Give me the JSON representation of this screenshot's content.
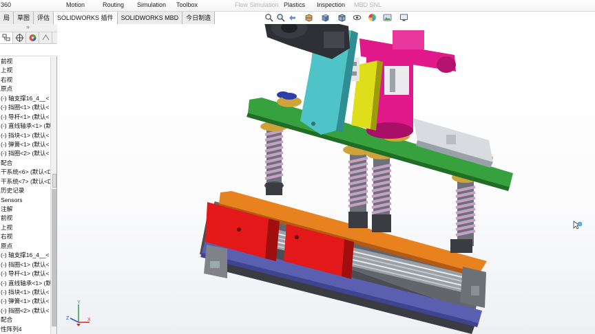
{
  "ribbon": {
    "items": [
      "360",
      "Motion",
      "Routing",
      "Simulation",
      "Toolbox",
      "Flow Simulation",
      "Plastics",
      "Inspection",
      "MBD SNL"
    ]
  },
  "tabs": [
    "局",
    "草图",
    "评估",
    "SOLIDWORKS 插件",
    "SOLIDWORKS MBD",
    "今日制造"
  ],
  "pane": {
    "collapse_glyph": "»",
    "tab_icons": [
      "feature-manager-icon",
      "property-manager-icon",
      "configuration-manager-icon",
      "dimxpert-icon"
    ],
    "tree": [
      "前视",
      "上视",
      "右视",
      "原点",
      "(-) 轴支撑16_4__<",
      "(-) 挡圈<1> (默认<",
      "(-) 导杆<1> (默认<",
      "(-) 直线轴承<1> (默",
      "(-) 挡块<1> (默认<",
      "(-) 弹簧<1> (默认<",
      "(-) 挡圈<2> (默认<",
      "配合",
      "干系统<6> (默认<D",
      "干系统<7> (默认<D",
      "历史记录",
      "Sensors",
      "注解",
      "前视",
      "上视",
      "右视",
      "原点",
      "(-) 轴支撑16_4__<",
      "(-) 挡圈<1> (默认<",
      "(-) 导杆<1> (默认<",
      "(-) 直线轴承<1> (默",
      "(-) 挡块<1> (默认<",
      "(-) 弹簧<1> (默认<",
      "(-) 挡圈<2> (默认<",
      "配合",
      "性阵列4"
    ]
  },
  "viewbar_icons": [
    "zoom-to-fit-icon",
    "zoom-area-icon",
    "previous-view-icon",
    "section-view-icon",
    "view-orientation-icon",
    "display-style-icon",
    "hide-show-icon",
    "edit-appearance-icon",
    "scene-icon",
    "display-settings-icon"
  ],
  "triad": {
    "x": "X",
    "y": "Y",
    "z": "Z"
  },
  "colors": {
    "green_plate": "#36a13d",
    "orange_plate": "#d9711b",
    "red_block": "#e01717",
    "magenta_cylinder": "#e0188a",
    "cyan_bracket": "#4ec4c9",
    "yellow_part": "#dede1a",
    "spring": "#c7a0c8",
    "navy_plate": "#5a5fb0",
    "gold_bushing": "#cfa23a"
  }
}
